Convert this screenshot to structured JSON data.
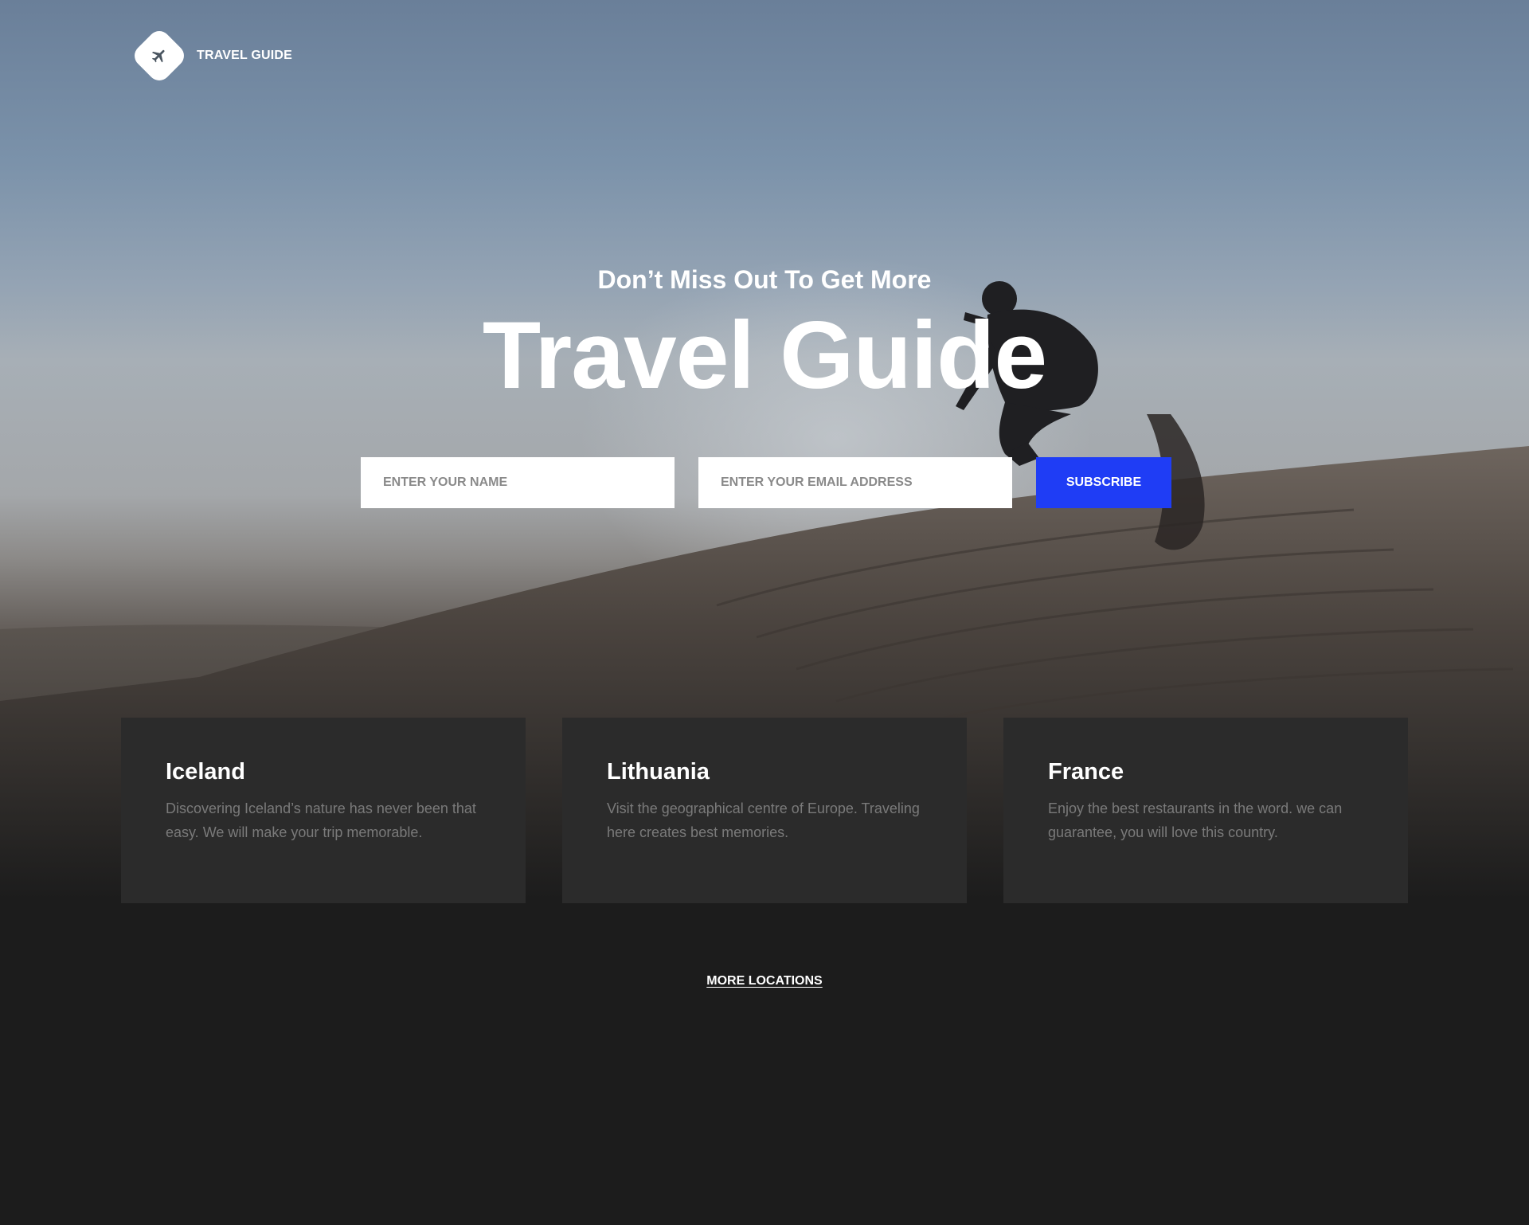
{
  "brand": {
    "name": "TRAVEL GUIDE",
    "logo_icon": "airplane-icon"
  },
  "hero": {
    "subtitle": "Don’t Miss Out To Get More",
    "title": "Travel Guide"
  },
  "form": {
    "name_placeholder": "ENTER YOUR NAME",
    "email_placeholder": "ENTER YOUR EMAIL ADDRESS",
    "subscribe_label": "SUBSCRIBE"
  },
  "locations": [
    {
      "name": "Iceland",
      "description": "Discovering Iceland’s nature has never been that easy. We will make your trip memorable."
    },
    {
      "name": "Lithuania",
      "description": "Visit the geographical centre of Europe. Traveling here creates best memories."
    },
    {
      "name": "France",
      "description": "Enjoy the best restaurants in the word. we can guarantee, you will love this country."
    }
  ],
  "more_link": "MORE LOCATIONS",
  "colors": {
    "accent": "#1f3df5",
    "card_bg": "#2b2b2b",
    "page_bg": "#1c1c1c"
  }
}
